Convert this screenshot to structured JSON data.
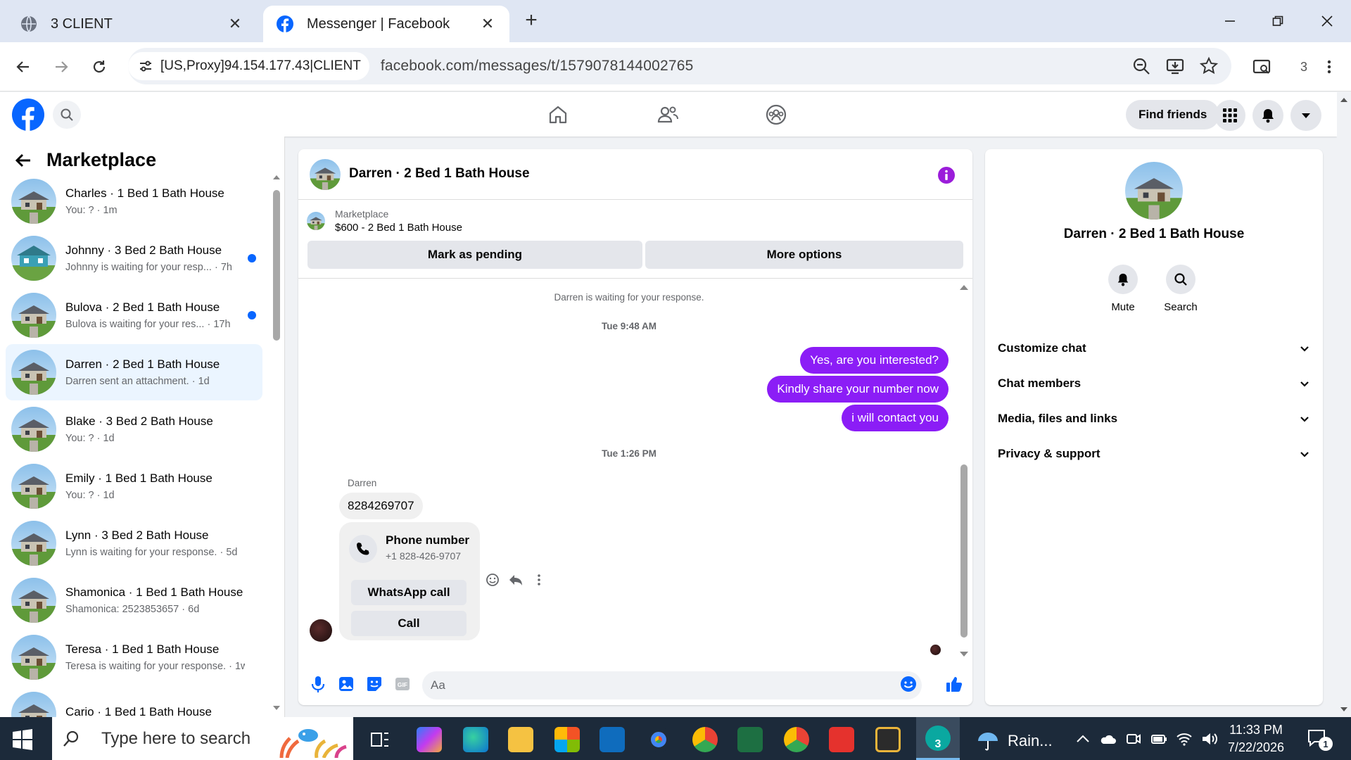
{
  "browser": {
    "tabs": [
      {
        "title": "3 CLIENT",
        "close": "✕"
      },
      {
        "title": "Messenger | Facebook",
        "close": "✕"
      }
    ],
    "new_tab": "+",
    "site_info": "[US,Proxy]94.154.177.43|CLIENT",
    "url": "facebook.com/messages/t/1579078144002765",
    "profile_count": "3"
  },
  "facebook": {
    "find_friends": "Find friends"
  },
  "left_panel": {
    "title": "Marketplace",
    "conversations": [
      {
        "name": "Charles · 1 Bed 1 Bath House",
        "preview": "You: ? · 1m",
        "unread": false,
        "active": false
      },
      {
        "name": "Johnny · 3 Bed 2 Bath House",
        "preview": "Johnny is waiting for your resp... · 7h",
        "unread": true,
        "active": false
      },
      {
        "name": "Bulova · 2 Bed 1 Bath House",
        "preview": "Bulova is waiting for your res... · 17h",
        "unread": true,
        "active": false
      },
      {
        "name": "Darren · 2 Bed 1 Bath House",
        "preview": "Darren sent an attachment. · 1d",
        "unread": false,
        "active": true
      },
      {
        "name": "Blake · 3 Bed 2 Bath House",
        "preview": "You: ? · 1d",
        "unread": false,
        "active": false
      },
      {
        "name": "Emily · 1 Bed 1 Bath House",
        "preview": "You: ? · 1d",
        "unread": false,
        "active": false
      },
      {
        "name": "Lynn · 3 Bed 2 Bath House",
        "preview": "Lynn is waiting for your response. · 5d",
        "unread": false,
        "active": false
      },
      {
        "name": "Shamonica · 1 Bed 1 Bath House",
        "preview": "Shamonica: 2523853657 · 6d",
        "unread": false,
        "active": false
      },
      {
        "name": "Teresa · 1 Bed 1 Bath House",
        "preview": "Teresa is waiting for your response. · 1w",
        "unread": false,
        "active": false
      },
      {
        "name": "Cario · 1 Bed 1 Bath House",
        "preview": "",
        "unread": false,
        "active": false
      }
    ]
  },
  "chat": {
    "title": "Darren · 2 Bed 1 Bath House",
    "marketplace_label": "Marketplace",
    "listing": "$600 - 2 Bed 1 Bath House",
    "mark_pending": "Mark as pending",
    "more_options": "More options",
    "waiting_notice": "Darren is waiting for your response.",
    "timestamp1": "Tue 9:48 AM",
    "outgoing": [
      "Yes, are you interested?",
      "Kindly share your number now",
      "i will contact you"
    ],
    "timestamp2": "Tue 1:26 PM",
    "sender": "Darren",
    "incoming_number": "8284269707",
    "phone_card": {
      "title": "Phone number",
      "number": "+1 828-426-9707",
      "whatsapp": "WhatsApp call",
      "call": "Call"
    },
    "composer_placeholder": "Aa"
  },
  "right_panel": {
    "name": "Darren · 2 Bed 1 Bath House",
    "mute": "Mute",
    "search": "Search",
    "sections": [
      "Customize chat",
      "Chat members",
      "Media, files and links",
      "Privacy & support"
    ]
  },
  "taskbar": {
    "search_placeholder": "Type here to search",
    "weather": "Rain...",
    "time": "11:33 PM",
    "date": "7/22/2026",
    "notifications": "1",
    "active_badge": "3"
  },
  "colors": {
    "fb_blue": "#0866ff",
    "outgoing_bubble": "#8b1df6",
    "info_icon": "#9b1dda"
  }
}
